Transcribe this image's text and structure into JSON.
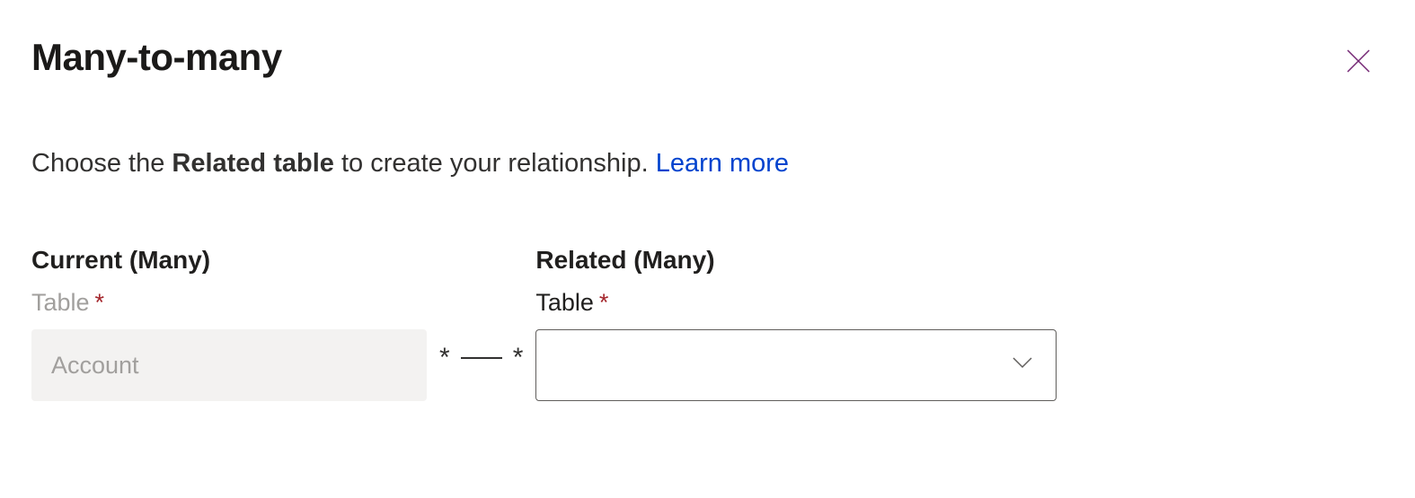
{
  "title": "Many-to-many",
  "description": {
    "prefix": "Choose the ",
    "bold": "Related table",
    "suffix": " to create your relationship. ",
    "link": "Learn more"
  },
  "current": {
    "heading": "Current (Many)",
    "label": "Table",
    "required_mark": "*",
    "value": "Account"
  },
  "connector": {
    "left": "*",
    "right": "*"
  },
  "related": {
    "heading": "Related (Many)",
    "label": "Table",
    "required_mark": "*",
    "value": ""
  }
}
